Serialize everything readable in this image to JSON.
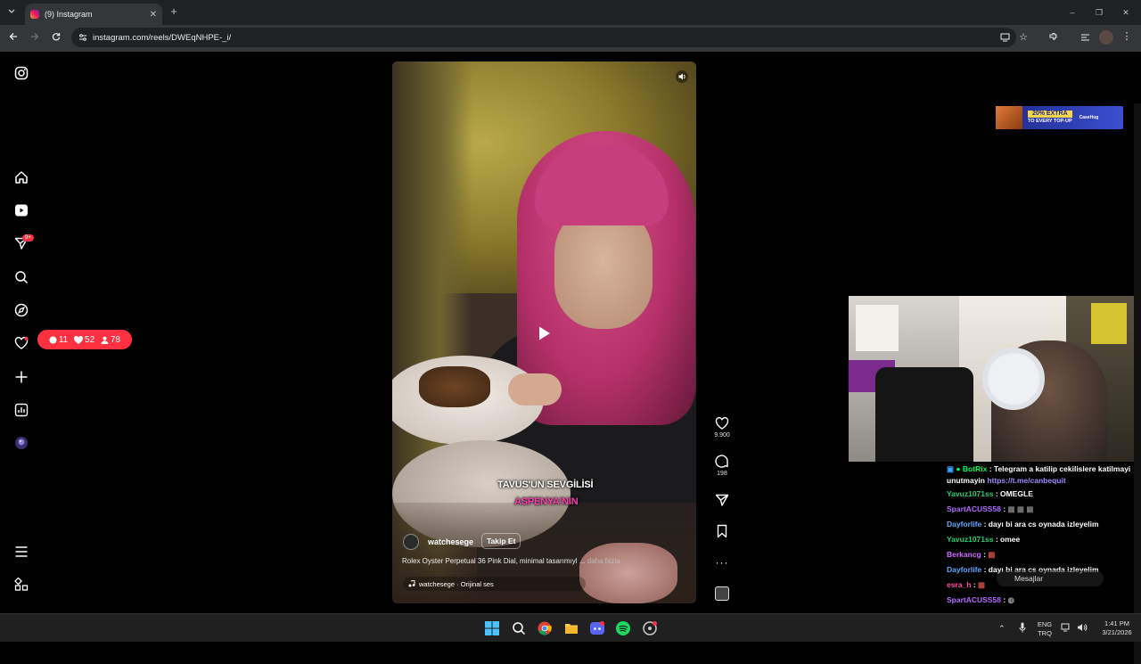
{
  "browser": {
    "tab_title": "(9) Instagram",
    "tab_close": "✕",
    "new_tab": "+",
    "url": "instagram.com/reels/DWEqNHPE-_i/",
    "window_controls": [
      "–",
      "❐",
      "✕"
    ]
  },
  "sidebar": {
    "items": [
      "instagram-logo",
      "home",
      "reels",
      "messages",
      "search",
      "explore",
      "notifications",
      "create",
      "dashboard",
      "profile",
      "more",
      "also-from-meta"
    ],
    "messages_badge": "9+"
  },
  "notification_pill": {
    "comments": "11",
    "likes": "52",
    "followers": "78"
  },
  "reel": {
    "username": "watchesege",
    "follow_label": "Takip Et",
    "description": "Rolex Oyster Perpetual 36 Pink Dial, minimal tasarımıyl ...",
    "more_label": "daha fazla",
    "audio": "watchesege · Orijinal ses",
    "caption_line1": "TAVUS'UN SEVGİLİSİ",
    "caption_line2": "ASPENYA'NIN",
    "likes": "9.900",
    "comments": "198"
  },
  "ad": {
    "text_line1": "20% EXTRA",
    "text_line2": "TO EVERY TOP-UP",
    "brand": "CaseHug"
  },
  "chat": {
    "messages": [
      {
        "name": "BotRix",
        "color": "#00ff5a",
        "text": ": Telegram a katilip cekilislere katilmayi unutmayin",
        "link": "https://t.me/canbequit"
      },
      {
        "name": "Yavuz1071ss",
        "color": "#2ecc71",
        "text": ": OMEGLE"
      },
      {
        "name": "SpartACUSS58",
        "color": "#b06bff",
        "text": ":"
      },
      {
        "name": "Dayforlife",
        "color": "#5fa8ff",
        "text": ": dayı bi ara cs oynada izleyelim"
      },
      {
        "name": "Yavuz1071ss",
        "color": "#2ecc71",
        "text": ": omee"
      },
      {
        "name": "Berkancg",
        "color": "#d06bff",
        "text": ":"
      },
      {
        "name": "Dayforlife",
        "color": "#5fa8ff",
        "text": ": dayı bi ara cs oynada izleyelim"
      },
      {
        "name": "esra_h",
        "color": "#ff4fa3",
        "text": ":"
      },
      {
        "name": "SpartACUSS58",
        "color": "#b06bff",
        "text": ":"
      }
    ],
    "input_placeholder": "Mesajlar"
  },
  "tray": {
    "lang1": "ENG",
    "lang2": "TRQ",
    "time": "1:41 PM",
    "date": "3/21/2026"
  }
}
